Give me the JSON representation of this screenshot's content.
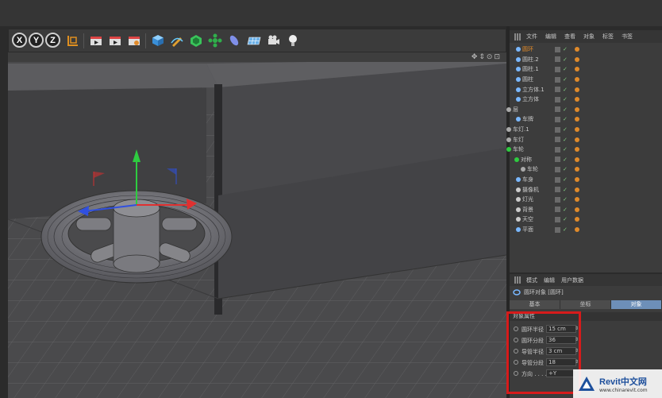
{
  "toolbar": {
    "axis_buttons": [
      "X",
      "Y",
      "Z"
    ]
  },
  "object_manager": {
    "menu": [
      "文件",
      "编辑",
      "查看",
      "对象",
      "标签",
      "书签"
    ],
    "objects": [
      {
        "name": "圆环",
        "selected": true
      },
      {
        "name": "圆柱.2"
      },
      {
        "name": "圆柱.1"
      },
      {
        "name": "圆柱"
      },
      {
        "name": "立方体.1"
      },
      {
        "name": "立方体"
      },
      {
        "name": "层"
      },
      {
        "name": "车牌"
      },
      {
        "name": "车灯.1"
      },
      {
        "name": "车灯"
      },
      {
        "name": "车轮"
      },
      {
        "name": "对称"
      },
      {
        "name": "车轮"
      },
      {
        "name": "车身"
      },
      {
        "name": "摄像机"
      },
      {
        "name": "灯光"
      },
      {
        "name": "背景"
      },
      {
        "name": "天空"
      },
      {
        "name": "平面"
      }
    ]
  },
  "attribute_manager": {
    "menu": [
      "模式",
      "编辑",
      "用户数据"
    ],
    "title": "圆环对象 [圆环]",
    "tabs": [
      {
        "label": "基本"
      },
      {
        "label": "坐标"
      },
      {
        "label": "对象",
        "active": true
      }
    ],
    "section": "对象属性",
    "properties": [
      {
        "label": "圆环半径",
        "value": "15 cm"
      },
      {
        "label": "圆环分段",
        "value": "36"
      },
      {
        "label": "导管半径",
        "value": "3 cm"
      },
      {
        "label": "导管分段",
        "value": "18"
      },
      {
        "label": "方向 . . . .",
        "value": "+Y"
      }
    ]
  },
  "watermark": {
    "title": "Revit中文网",
    "url": "www.chinarevit.com"
  },
  "colors": {
    "highlight": "#d61b1b",
    "active_tab": "#6d8fb8",
    "selected_object": "#e08a2a"
  }
}
